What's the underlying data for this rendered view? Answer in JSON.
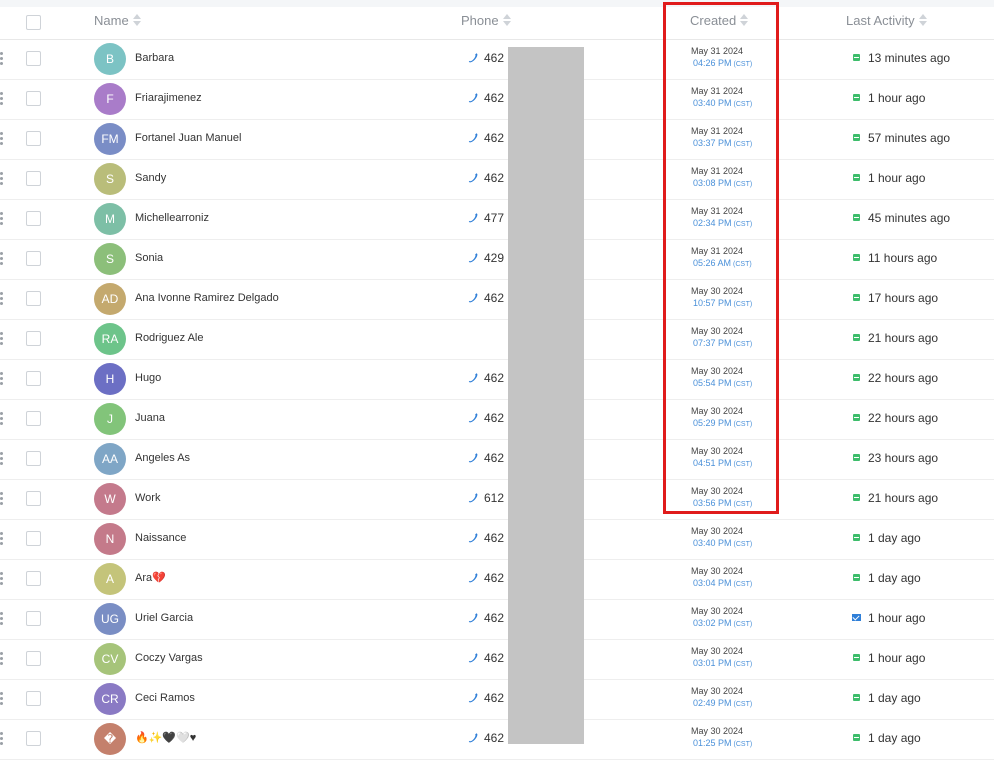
{
  "header": {
    "name_label": "Name",
    "phone_label": "Phone",
    "created_label": "Created",
    "last_activity_label": "Last Activity"
  },
  "rows": [
    {
      "initials": "B",
      "name": "Barbara",
      "phone": "462",
      "date": "May 31 2024",
      "time": "04:26 PM",
      "tz": "(CST)",
      "activity": "13 minutes ago",
      "activity_icon": "chat-icon",
      "color": "#7cc3c4"
    },
    {
      "initials": "F",
      "name": "Friarajimenez",
      "phone": "462",
      "date": "May 31 2024",
      "time": "03:40 PM",
      "tz": "(CST)",
      "activity": "1 hour ago",
      "activity_icon": "chat-icon",
      "color": "#a97cc9"
    },
    {
      "initials": "FM",
      "name": "Fortanel Juan Manuel",
      "phone": "462",
      "date": "May 31 2024",
      "time": "03:37 PM",
      "tz": "(CST)",
      "activity": "57 minutes ago",
      "activity_icon": "chat-icon",
      "color": "#7a8dc6"
    },
    {
      "initials": "S",
      "name": "Sandy",
      "phone": "462",
      "date": "May 31 2024",
      "time": "03:08 PM",
      "tz": "(CST)",
      "activity": "1 hour ago",
      "activity_icon": "chat-icon",
      "color": "#b9bd7a"
    },
    {
      "initials": "M",
      "name": "Michellearroniz",
      "phone": "477",
      "date": "May 31 2024",
      "time": "02:34 PM",
      "tz": "(CST)",
      "activity": "45 minutes ago",
      "activity_icon": "chat-icon",
      "color": "#7dbfa6"
    },
    {
      "initials": "S",
      "name": "Sonia",
      "phone": "429",
      "date": "May 31 2024",
      "time": "05:26 AM",
      "tz": "(CST)",
      "activity": "11 hours ago",
      "activity_icon": "chat-icon",
      "color": "#8cbf7a"
    },
    {
      "initials": "AD",
      "name": "Ana Ivonne Ramirez Delgado",
      "phone": "462",
      "date": "May 30 2024",
      "time": "10:57 PM",
      "tz": "(CST)",
      "activity": "17 hours ago",
      "activity_icon": "chat-icon",
      "color": "#c4a96e"
    },
    {
      "initials": "RA",
      "name": "Rodriguez Ale",
      "phone": "",
      "date": "May 30 2024",
      "time": "07:37 PM",
      "tz": "(CST)",
      "activity": "21 hours ago",
      "activity_icon": "chat-icon",
      "color": "#6dc48a"
    },
    {
      "initials": "H",
      "name": "Hugo",
      "phone": "462",
      "date": "May 30 2024",
      "time": "05:54 PM",
      "tz": "(CST)",
      "activity": "22 hours ago",
      "activity_icon": "chat-icon",
      "color": "#6c6fc4"
    },
    {
      "initials": "J",
      "name": "Juana",
      "phone": "462",
      "date": "May 30 2024",
      "time": "05:29 PM",
      "tz": "(CST)",
      "activity": "22 hours ago",
      "activity_icon": "chat-icon",
      "color": "#82c47a"
    },
    {
      "initials": "AA",
      "name": "Angeles As",
      "phone": "462",
      "date": "May 30 2024",
      "time": "04:51 PM",
      "tz": "(CST)",
      "activity": "23 hours ago",
      "activity_icon": "chat-icon",
      "color": "#7fa6c6"
    },
    {
      "initials": "W",
      "name": "Work",
      "phone": "612",
      "date": "May 30 2024",
      "time": "03:56 PM",
      "tz": "(CST)",
      "activity": "21 hours ago",
      "activity_icon": "chat-icon",
      "color": "#c47a8c"
    },
    {
      "initials": "N",
      "name": "Naissance",
      "phone": "462 6",
      "date": "May 30 2024",
      "time": "03:40 PM",
      "tz": "(CST)",
      "activity": "1 day ago",
      "activity_icon": "chat-icon",
      "color": "#c47a8a"
    },
    {
      "initials": "A",
      "name": "Ara💔",
      "phone": "462 3",
      "date": "May 30 2024",
      "time": "03:04 PM",
      "tz": "(CST)",
      "activity": "1 day ago",
      "activity_icon": "chat-icon",
      "color": "#c4c47a"
    },
    {
      "initials": "UG",
      "name": "Uriel Garcia",
      "phone": "462 2",
      "date": "May 30 2024",
      "time": "03:02 PM",
      "tz": "(CST)",
      "activity": "1 hour ago",
      "activity_icon": "mail-icon",
      "color": "#7a8ec4"
    },
    {
      "initials": "CV",
      "name": "Coczy Vargas",
      "phone": "462 1",
      "date": "May 30 2024",
      "time": "03:01 PM",
      "tz": "(CST)",
      "activity": "1 hour ago",
      "activity_icon": "chat-icon",
      "color": "#a6c47a"
    },
    {
      "initials": "CR",
      "name": "Ceci Ramos",
      "phone": "462 1",
      "date": "May 30 2024",
      "time": "02:49 PM",
      "tz": "(CST)",
      "activity": "1 day ago",
      "activity_icon": "chat-icon",
      "color": "#8a7ac4"
    },
    {
      "initials": "�",
      "name": "🔥✨🖤🤍♥",
      "phone": "462 2",
      "date": "May 30 2024",
      "time": "01:25 PM",
      "tz": "(CST)",
      "activity": "1 day ago",
      "activity_icon": "chat-icon",
      "color": "#c4806c"
    }
  ],
  "colors": {
    "highlight": "#e01b1b",
    "time_text": "#4a90d9",
    "activity_chat": "#3dbd6b",
    "activity_mail": "#2f7fd8",
    "redaction": "#c4c4c4"
  }
}
